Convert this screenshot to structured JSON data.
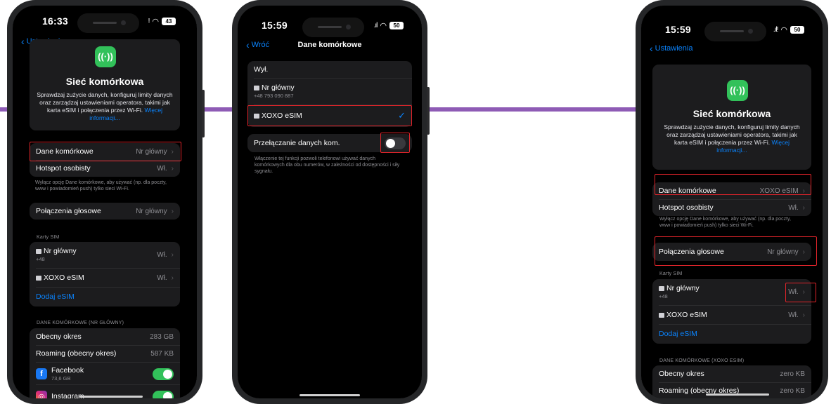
{
  "colors": {
    "connector": "#8e5bb5",
    "highlight": "#e0242a",
    "accent": "#0a84ff",
    "toggle_on": "#32c15a"
  },
  "phone1": {
    "status": {
      "time": "16:33",
      "battery": "43"
    },
    "nav": {
      "back": "Ustawienia"
    },
    "hero": {
      "icon": "antenna-icon",
      "title": "Sieć komórkowa",
      "desc": "Sprawdzaj zużycie danych, konfiguruj limity danych oraz zarządzaj ustawieniami operatora, takimi jak karta eSIM i połączenia przez Wi-Fi.",
      "link": "Więcej informacji..."
    },
    "data_row": {
      "label": "Dane komórkowe",
      "value": "Nr główny"
    },
    "hotspot_row": {
      "label": "Hotspot osobisty",
      "value": "Wł."
    },
    "note": "Wyłącz opcję Dane komórkowe, aby używać (np. dla poczty, www i powiadomień push) tylko sieci Wi-Fi.",
    "voice_row": {
      "label": "Połączenia głosowe",
      "value": "Nr główny"
    },
    "sim_section": "Karty SIM",
    "sims": [
      {
        "label": "Nr główny",
        "sub": "+48",
        "value": "Wł."
      },
      {
        "label": "XOXO eSIM",
        "sub": "",
        "value": "Wł."
      }
    ],
    "add_esim": "Dodaj eSIM",
    "usage_section": "DANE KOMÓRKOWE (NR GŁÓWNY)",
    "usage": [
      {
        "label": "Obecny okres",
        "value": "283 GB"
      },
      {
        "label": "Roaming (obecny okres)",
        "value": "587 KB"
      }
    ],
    "apps": [
      {
        "name": "Facebook",
        "size": "73,6 GB",
        "icon": "facebook-icon",
        "on": true
      },
      {
        "name": "Instagram",
        "size": "",
        "icon": "instagram-icon",
        "on": true
      }
    ]
  },
  "phone2": {
    "status": {
      "time": "15:59",
      "battery": "50"
    },
    "nav": {
      "back": "Wróć",
      "title": "Dane komórkowe"
    },
    "options_header": "Wył.",
    "options": [
      {
        "label": "Nr główny",
        "sub": "+48 793 090 887",
        "checked": false
      },
      {
        "label": "XOXO eSIM",
        "sub": "",
        "checked": true
      }
    ],
    "switch_row": {
      "label": "Przełączanie danych kom.",
      "on": false
    },
    "switch_note": "Włączenie tej funkcji pozwoli telefonowi używać danych komórkowych dla obu numerów, w zależności od dostępności i siły sygnału."
  },
  "phone3": {
    "status": {
      "time": "15:59",
      "battery": "50"
    },
    "nav": {
      "back": "Ustawienia"
    },
    "hero": {
      "icon": "antenna-icon",
      "title": "Sieć komórkowa",
      "desc": "Sprawdzaj zużycie danych, konfiguruj limity danych oraz zarządzaj ustawieniami operatora, takimi jak karta eSIM i połączenia przez Wi-Fi.",
      "link": "Więcej informacji..."
    },
    "data_row": {
      "label": "Dane komórkowe",
      "value": "XOXO eSIM"
    },
    "hotspot_row": {
      "label": "Hotspot osobisty",
      "value": "Wł."
    },
    "note": "Wyłącz opcję Dane komórkowe, aby używać (np. dla poczty, www i powiadomień push) tylko sieci Wi-Fi.",
    "voice_row": {
      "label": "Połączenia głosowe",
      "value": "Nr główny"
    },
    "sim_section": "Karty SIM",
    "sims": [
      {
        "label": "Nr główny",
        "sub": "+48",
        "value": "Wł."
      },
      {
        "label": "XOXO eSIM",
        "sub": "",
        "value": "Wł."
      }
    ],
    "add_esim": "Dodaj eSIM",
    "usage_section": "DANE KOMÓRKOWE (XOXO ESIM)",
    "usage": [
      {
        "label": "Obecny okres",
        "value": "zero KB"
      },
      {
        "label": "Roaming (obecny okres)",
        "value": "zero KB"
      }
    ]
  }
}
